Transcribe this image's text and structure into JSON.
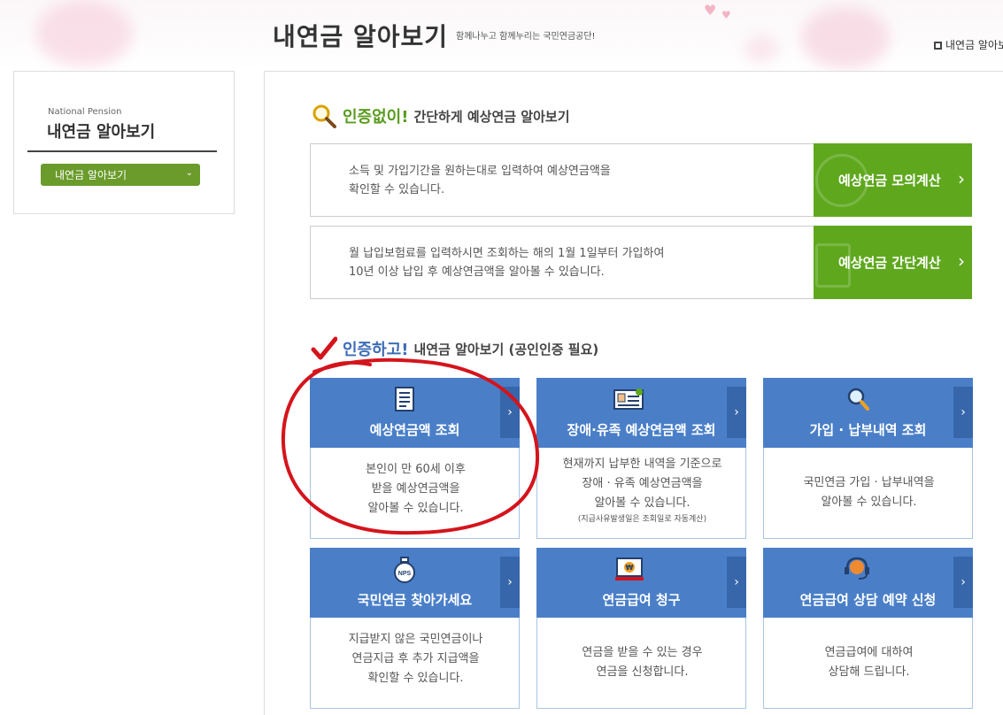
{
  "header": {
    "title": "내연금 알아보기",
    "subtitle": "함께나누고 함께누리는 국민연금공단!",
    "location": "내연금 알아보"
  },
  "sidebar": {
    "english_label": "National Pension",
    "title": "내연금 알아보기",
    "select_value": "내연금 알아보기"
  },
  "section1": {
    "strong": "인증없이!",
    "rest": "간단하게 예상연금 알아보기",
    "rows": [
      {
        "line1": "소득 및 가입기간을 원하는대로 입력하여 예상연금액을",
        "line2": "확인할 수 있습니다.",
        "button": "예상연금 모의계산",
        "chevron": "›"
      },
      {
        "line1": "월 납입보험료를 입력하시면 조회하는 해의 1월 1일부터 가입하여",
        "line2": "10년 이상 납입 후 예상연금액을 알아볼 수 있습니다.",
        "button": "예상연금 간단계산",
        "chevron": "›"
      }
    ]
  },
  "section2": {
    "strong": "인증하고!",
    "rest": "내연금 알아보기 (공인인증 필요)"
  },
  "cards": [
    {
      "title": "예상연금액 조회",
      "lines": [
        "본인이 만 60세 이후",
        "받을 예상연금액을",
        "알아볼 수 있습니다."
      ],
      "icon": "document-icon",
      "chevron": "›"
    },
    {
      "title": "장애·유족 예상연금액 조회",
      "lines": [
        "현재까지 납부한 내역을 기준으로",
        "장애 · 유족 예상연금액을",
        "알아볼 수 있습니다."
      ],
      "note": "(지급사유발생일은 조회일로 자동계산)",
      "icon": "id-card-icon",
      "chevron": "›"
    },
    {
      "title": "가입 · 납부내역 조회",
      "lines": [
        "국민연금 가입 · 납부내역을",
        "알아볼 수 있습니다."
      ],
      "icon": "magnifier-icon",
      "chevron": "›"
    },
    {
      "title": "국민연금 찾아가세요",
      "lines": [
        "지급받지 않은 국민연금이나",
        "연금지급 후 추가 지급액을",
        "확인할 수 있습니다."
      ],
      "icon": "nps-bag-icon",
      "icon_text": "NPS",
      "chevron": "›"
    },
    {
      "title": "연금급여 청구",
      "lines": [
        "연금을 받을 수 있는 경우",
        "연금을 신청합니다."
      ],
      "icon": "monitor-won-icon",
      "icon_text": "₩",
      "chevron": "›"
    },
    {
      "title": "연금급여 상담 예약 신청",
      "lines": [
        "연금급여에 대하여",
        "상담해 드립니다."
      ],
      "icon": "headset-icon",
      "chevron": "›"
    }
  ],
  "colors": {
    "green": "#5fa81e",
    "blue": "#4a7fc8",
    "blue_dark": "#3766aa",
    "annotation_red": "#d4141c"
  }
}
